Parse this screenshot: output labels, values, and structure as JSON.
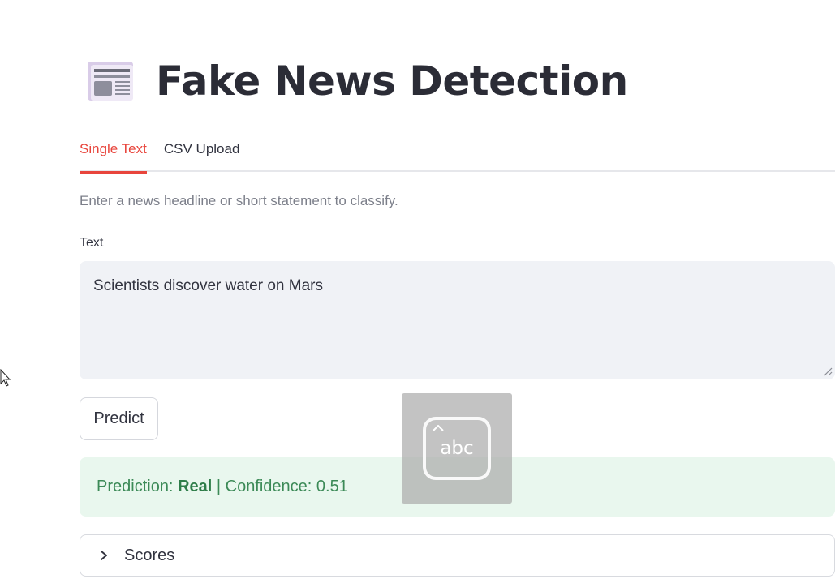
{
  "app": {
    "title": "Fake News Detection",
    "title_icon": "newspaper-icon"
  },
  "tabs": [
    {
      "label": "Single Text",
      "active": true
    },
    {
      "label": "CSV Upload",
      "active": false
    }
  ],
  "caption": "Enter a news headline or short statement to classify.",
  "text_input": {
    "label": "Text",
    "value": "Scientists discover water on Mars"
  },
  "predict_button": {
    "label": "Predict"
  },
  "result": {
    "prefix": "Prediction: ",
    "label": "Real",
    "suffix": " | Confidence: 0.51"
  },
  "scores_expander": {
    "label": "Scores",
    "icon": "chevron-right-icon"
  },
  "overlay": {
    "text": "abc",
    "icon": "keyboard-input-icon"
  },
  "colors": {
    "accent": "#e8453c",
    "success_bg": "#e9f7ee",
    "success_text": "#3c8a57",
    "input_bg": "#f0f2f6"
  }
}
